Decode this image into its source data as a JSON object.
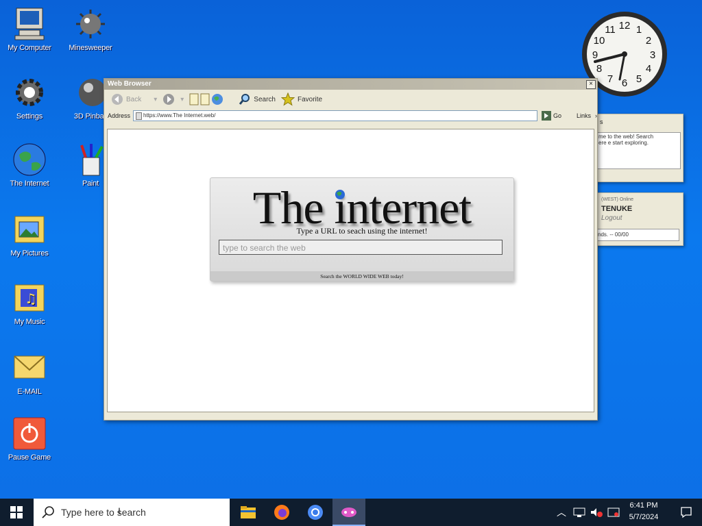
{
  "desktop": {
    "icons": [
      {
        "label": "My Computer"
      },
      {
        "label": "Minesweeper"
      },
      {
        "label": "Settings"
      },
      {
        "label": "3D Pinball"
      },
      {
        "label": "The Internet"
      },
      {
        "label": "Paint"
      },
      {
        "label": "My Pictures"
      },
      {
        "label": "My Music"
      },
      {
        "label": "E-MAIL"
      },
      {
        "label": "Pause Game"
      }
    ]
  },
  "clock": {
    "numbers": [
      "12",
      "1",
      "2",
      "3",
      "4",
      "5",
      "6",
      "7",
      "8",
      "9",
      "10",
      "11"
    ]
  },
  "widgets": {
    "notes": {
      "title": "s",
      "text": "me to the web! Search\nere e start exploring."
    },
    "account": {
      "small": "(WEST) Online",
      "name": "TENUKE",
      "link": "Logout",
      "status": "nds. -- 00/00"
    }
  },
  "browser": {
    "title": "Web Browser",
    "toolbar": {
      "back": "Back",
      "search": "Search",
      "favorite": "Favorite"
    },
    "address_label": "Address",
    "address_value": "https://www.The Internet.web/",
    "go_label": "Go",
    "links_label": "Links"
  },
  "page": {
    "title": "The internet",
    "subtitle": "Type a URL to seach using the internet!",
    "search_placeholder": "type to search the web",
    "footer": "Search the WORLD WIDE WEB today!"
  },
  "taskbar": {
    "search_placeholder": "Type here to search",
    "time": "6:41 PM",
    "date": "5/7/2024"
  },
  "colors": {
    "desktop": "#0b79ee",
    "taskbar": "#0f1d2e",
    "window": "#ece9d8"
  }
}
